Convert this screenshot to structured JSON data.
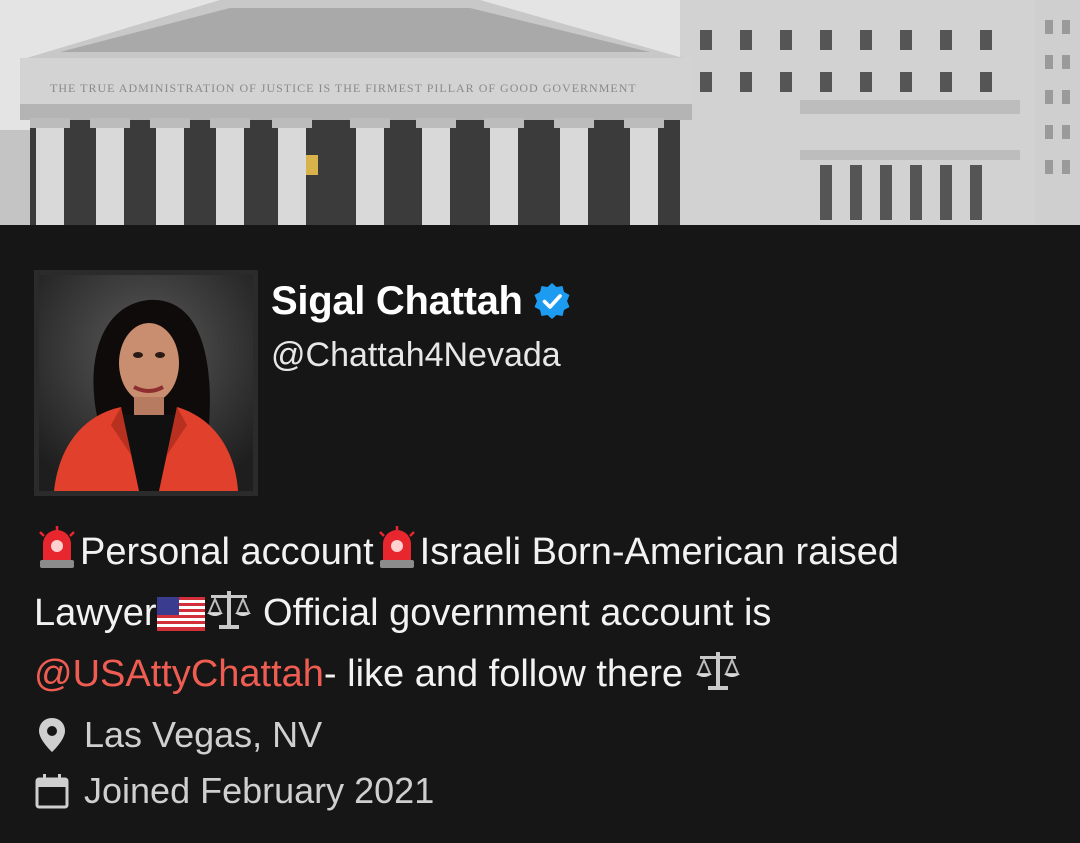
{
  "profile": {
    "display_name": "Sigal Chattah",
    "verified": true,
    "handle": "@Chattah4Nevada",
    "banner_inscription": "THE TRUE ADMINISTRATION OF JUSTICE IS THE FIRMEST PILLAR OF GOOD GOVERNMENT"
  },
  "bio": {
    "part1": "Personal account",
    "part2": "Israeli Born-American raised",
    "part3": "Lawyer",
    "part4": " Official government account is",
    "mention": "@USAttyChattah",
    "part5": "- like and follow there "
  },
  "meta": {
    "location": "Las Vegas, NV",
    "joined": "Joined February 2021"
  },
  "icons": {
    "verified": "verified-badge-icon",
    "siren": "police-light-emoji",
    "flag": "us-flag-emoji",
    "scales": "balance-scale-emoji",
    "location": "location-pin-icon",
    "calendar": "calendar-icon"
  },
  "colors": {
    "background": "#161616",
    "mention": "#ef5d52",
    "verified": "#1d9bf0",
    "meta_text": "#cfcfcf"
  }
}
